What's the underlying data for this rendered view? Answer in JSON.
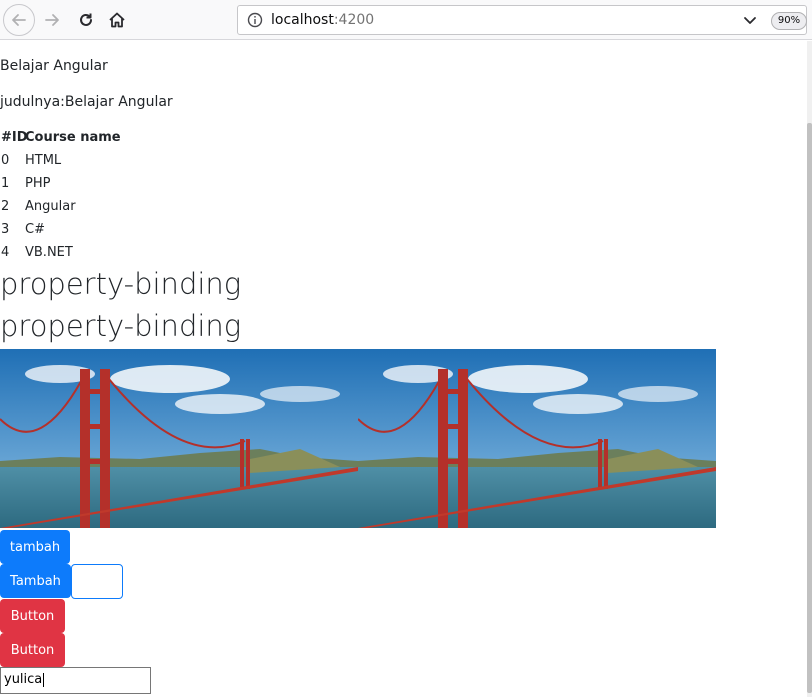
{
  "browser": {
    "url_host": "localhost",
    "url_port": ":4200",
    "zoom": "90%"
  },
  "app": {
    "title": "Belajar Angular",
    "subtitle": "judulnya:Belajar Angular"
  },
  "courses": {
    "headers": [
      "#ID",
      "Course name"
    ],
    "rows": [
      {
        "id": "0",
        "name": "HTML"
      },
      {
        "id": "1",
        "name": "PHP"
      },
      {
        "id": "2",
        "name": "Angular"
      },
      {
        "id": "3",
        "name": "C#"
      },
      {
        "id": "4",
        "name": "VB.NET"
      }
    ]
  },
  "headings": [
    "property-binding",
    "property-binding"
  ],
  "buttons": {
    "tambah_lower": "tambah",
    "tambah_upper": "Tambah",
    "button1": "Button",
    "button2": "Button"
  },
  "inputs": {
    "name_value": "yulica"
  },
  "colors": {
    "primary": "#0d7bfb",
    "danger": "#e03444"
  }
}
